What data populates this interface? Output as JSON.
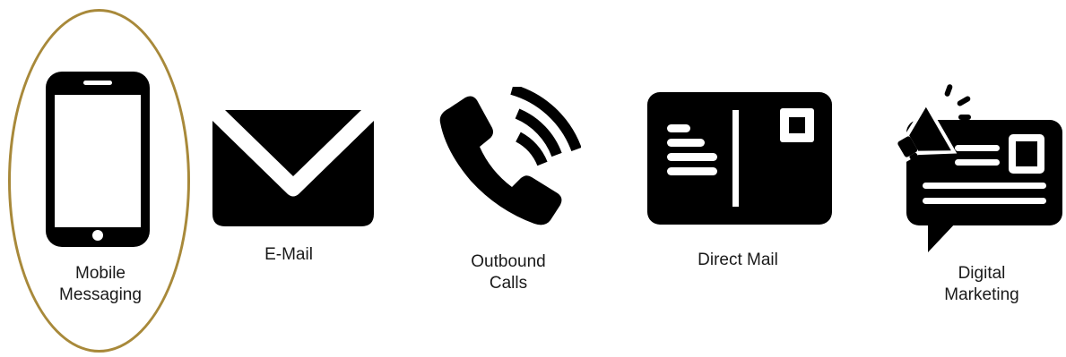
{
  "highlight_color": "#A8893A",
  "icon_color": "#000000",
  "channels": [
    {
      "icon": "smartphone-icon",
      "label_lines": [
        "Mobile",
        "Messaging"
      ],
      "highlighted": true
    },
    {
      "icon": "envelope-icon",
      "label_lines": [
        "E-Mail"
      ],
      "highlighted": false
    },
    {
      "icon": "phone-call-icon",
      "label_lines": [
        "Outbound",
        "Calls"
      ],
      "highlighted": false
    },
    {
      "icon": "postcard-icon",
      "label_lines": [
        "Direct Mail"
      ],
      "highlighted": false
    },
    {
      "icon": "megaphone-ad-icon",
      "label_lines": [
        "Digital",
        "Marketing"
      ],
      "highlighted": false
    }
  ]
}
